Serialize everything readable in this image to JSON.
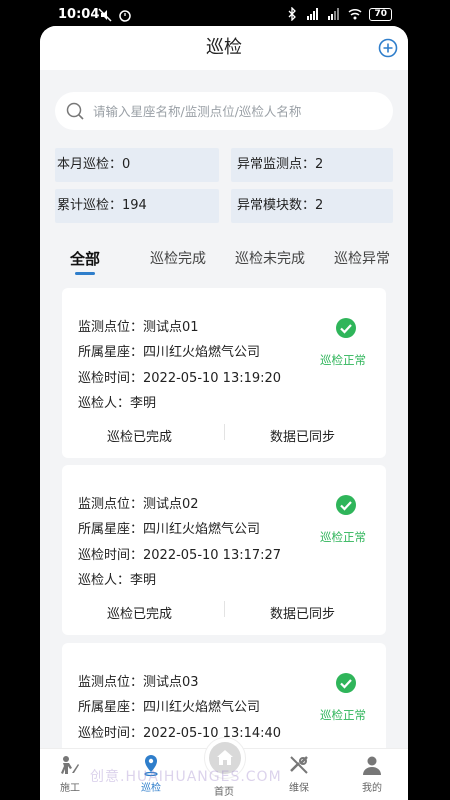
{
  "status_bar": {
    "time": "10:04",
    "battery": "70"
  },
  "header": {
    "title": "巡检"
  },
  "search": {
    "placeholder": "请输入星座名称/监测点位/巡检人名称"
  },
  "stats": {
    "month_label": "本月巡检：0",
    "abnormal_points_label": "异常监测点：2",
    "total_label": "累计巡检：194",
    "abnormal_modules_label": "异常模块数：2"
  },
  "tabs": [
    {
      "label": "全部"
    },
    {
      "label": "巡检完成"
    },
    {
      "label": "巡检未完成"
    },
    {
      "label": "巡检异常"
    }
  ],
  "cards": [
    {
      "point": "监测点位：测试点01",
      "constellation": "所属星座：四川红火焰燃气公司",
      "time": "巡检时间：2022-05-10 13:19:20",
      "inspector": "巡检人：李明",
      "status": "巡检正常",
      "left_action": "巡检已完成",
      "right_action": "数据已同步"
    },
    {
      "point": "监测点位：测试点02",
      "constellation": "所属星座：四川红火焰燃气公司",
      "time": "巡检时间：2022-05-10 13:17:27",
      "inspector": "巡检人：李明",
      "status": "巡检正常",
      "left_action": "巡检已完成",
      "right_action": "数据已同步"
    },
    {
      "point": "监测点位：测试点03",
      "constellation": "所属星座：四川红火焰燃气公司",
      "time": "巡检时间：2022-05-10 13:14:40",
      "inspector": "",
      "status": "巡检正常",
      "left_action": "",
      "right_action": ""
    }
  ],
  "nav": [
    {
      "label": "施工",
      "icon": "construction-worker-icon"
    },
    {
      "label": "巡检",
      "icon": "location-pin-icon"
    },
    {
      "label": "首页",
      "icon": "home-icon"
    },
    {
      "label": "维保",
      "icon": "tools-icon"
    },
    {
      "label": "我的",
      "icon": "user-icon"
    }
  ],
  "watermark": "创意.HUAIHUANGES.COM",
  "colors": {
    "accent": "#2f7ecb",
    "success": "#2fb55a",
    "stat_bg": "#e6ecf4"
  }
}
